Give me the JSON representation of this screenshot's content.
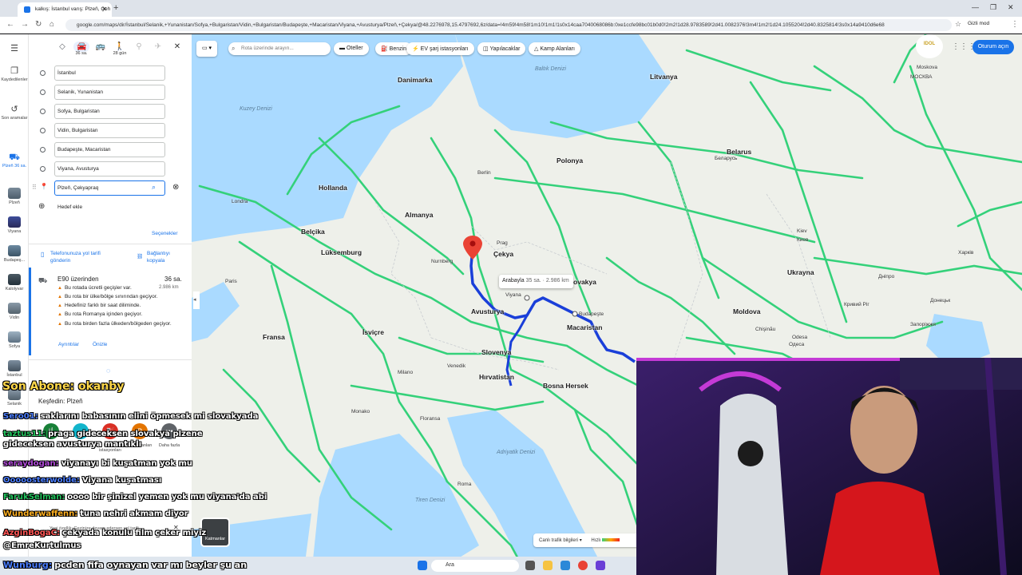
{
  "browser": {
    "tabs": [
      {
        "title": "kalkış: İstanbul varış: Plzeň, Çeh"
      }
    ],
    "url": "google.com/maps/dir/İstanbul/Selanik,+Yunanistan/Sofya,+Bulgaristan/Vidin,+Bulgaristan/Budapeşte,+Macaristan/Viyana,+Avusturya/Plzeň,+Çekya/@48.2276978,15.4797692,6z/data=!4m59!4m58!1m10!1m1!1s0x14caa7040068086b:0xe1ccfe98bc01b0d0!2m2!1d28.9783589!2d41.0082376!3m4!1m2!1d24.1055204!2d40.8325814!3s0x14a9410d6e68",
    "incognito_label": "Gizli mod"
  },
  "rail": [
    {
      "label": "Kaydedilenler",
      "icon": "bookmark-icon"
    },
    {
      "label": "Son aramalar",
      "icon": "history-icon"
    },
    {
      "label": "Plzeň 36 sa.",
      "icon": "directions-icon"
    },
    {
      "label": "Plzeň",
      "icon": "thumbnail"
    },
    {
      "label": "Viyana",
      "icon": "thumbnail"
    },
    {
      "label": "Budapeş...",
      "icon": "thumbnail"
    },
    {
      "label": "Kalolyvar",
      "icon": "thumbnail"
    },
    {
      "label": "Vidin",
      "icon": "thumbnail"
    },
    {
      "label": "Sofya",
      "icon": "thumbnail"
    },
    {
      "label": "İstanbul",
      "icon": "thumbnail"
    },
    {
      "label": "Selanik",
      "icon": "thumbnail"
    }
  ],
  "directions": {
    "modes": [
      {
        "name": "best",
        "time": ""
      },
      {
        "name": "car",
        "time": "36 sa."
      },
      {
        "name": "transit",
        "time": ""
      },
      {
        "name": "walk",
        "time": "28 gün"
      },
      {
        "name": "bike",
        "time": ""
      },
      {
        "name": "flight",
        "time": ""
      }
    ],
    "waypoints": [
      "İstanbul",
      "Selanik, Yunanistan",
      "Sofya, Bulgaristan",
      "Vidin, Bulgaristan",
      "Budapeşte, Macaristan",
      "Viyana, Avusturya",
      "Plzeň, Çekyapraq"
    ],
    "add_destination": "Hedef ekle",
    "options": "Seçenekler",
    "send_phone": "Telefonunuza yol tarifi gönderin",
    "copy_link": "Bağlantıyı kopyala",
    "route": {
      "via": "E90 üzerinden",
      "time": "36 sa.",
      "distance": "2.986 km",
      "warnings": [
        "Bu rotada ücretli geçişler var.",
        "Bu rota bir ülke/bölge sınırından geçiyor.",
        "Hedefiniz farklı bir saat diliminde.",
        "Bu rota Romanya içinden geçiyor.",
        "Bu rota birden fazla ülkeden/bölgeden geçiyor."
      ],
      "details": "Ayrıntılar",
      "preview": "Önizle"
    },
    "explore": "Keşfedin: Plzeň",
    "categories": [
      "",
      "",
      "Benzin istasyonları",
      "Park Alanları",
      "Daha fazla"
    ]
  },
  "map": {
    "search_placeholder": "Rota üzerinde arayın...",
    "chips": [
      "Oteller",
      "Benzin",
      "EV şarj istasyonları",
      "Yapılacaklar",
      "Kamp Alanları"
    ],
    "signin": "Oturum açın",
    "logo_text": "IDOL",
    "route_label": "Arabayla",
    "route_info": "35 sa. · 2.986 km",
    "traffic_legend": "Canlı trafik bilgileri",
    "traffic_fast": "Hızlı",
    "layers_label": "Katmanlar",
    "countries": [
      "Danimarka",
      "Litvanya",
      "Belarus",
      "Polonya",
      "Hollanda",
      "Almanya",
      "Belçika",
      "Lüksemburg",
      "Çekya",
      "Slovakya",
      "Avusturya",
      "Macaristan",
      "Ukrayna",
      "Moldova",
      "Fransa",
      "İsviçre",
      "Slovenya",
      "Hırvatistan",
      "Bosna Hersek",
      "Monako"
    ],
    "cities": [
      "Moskova",
      "Berlin",
      "Londra",
      "Prag",
      "Nurnberg",
      "Viyana",
      "Budapeşte",
      "Kiev",
      "Paris",
      "Milano",
      "Venedik",
      "Floransa",
      "Roma"
    ],
    "foreign": [
      "МОСКВА",
      "Беларусь",
      "Киев",
      "Кривий Ріг",
      "Одеса",
      "Донецьк",
      "Харків",
      "Запоріжжя",
      "Дніпро",
      "Chişinău",
      "Odesa"
    ],
    "seas": [
      "Adriyatik Denizi",
      "Tiren Denizi",
      "Kuzey Denizi",
      "Baltık Denizi"
    ]
  },
  "overlay": {
    "sub_label": "Son Abone: okanby",
    "chat": [
      {
        "nick": "Sero01:",
        "msg": "saklarını babasının elini öpmesek mi slovakyada",
        "color": "#4a7dff"
      },
      {
        "nick": "taztus11:",
        "msg": "praga gideceksen slovakya plzene gideceksen avusturya mantıklı",
        "color": "#22c55e"
      },
      {
        "nick": "seraydogan:",
        "msg": "viyanayı bi kuşatman yok mu",
        "color": "#b04ad8"
      },
      {
        "nick": "Ooooosterwolde:",
        "msg": "Viyana kuşatması",
        "color": "#4a7dff"
      },
      {
        "nick": "FarukSelman:",
        "msg": "oooo bir şinizel yemen yok mu viyana'da abi",
        "color": "#22c55e"
      },
      {
        "nick": "Wunderwaffenn:",
        "msg": "tuna nehri akmam diyor",
        "color": "#ffb020"
      },
      {
        "nick": "AzginBogaC:",
        "msg": "çekyada konulu film çeker miyiz",
        "color": "#ff5555"
      },
      {
        "nick": "",
        "msg": "@EmreKurtulmus",
        "color": "#ffffff"
      },
      {
        "nick": "Wunburg:",
        "msg": "pcden fifa oynayan var mı beyler şu an",
        "color": "#4a7dff"
      }
    ],
    "small_note": "Yeni özellik: Gezinize devam edersen yol tarifi"
  },
  "taskbar": {
    "search": "Ara"
  },
  "colors": {
    "route": "#1a3fd9",
    "roads": "#34d17a",
    "map_bg": "#eef0ea",
    "accent": "#1a73e8"
  }
}
